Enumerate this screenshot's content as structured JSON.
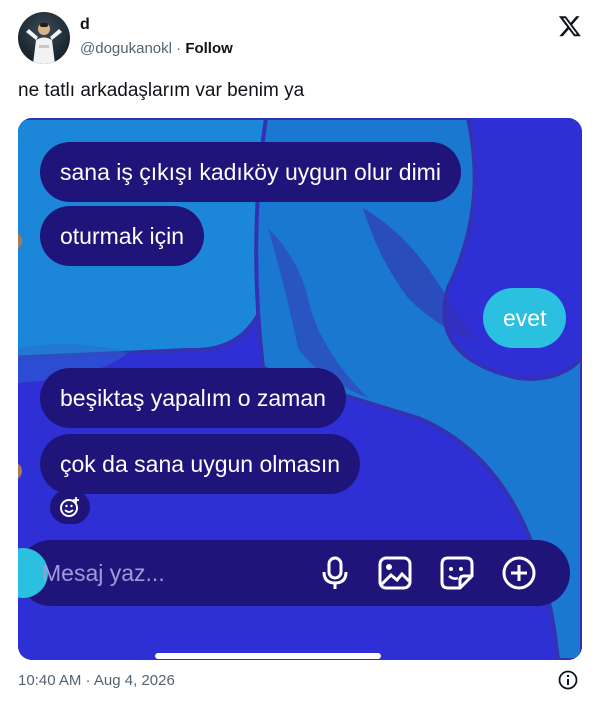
{
  "tweet": {
    "display_name": "d",
    "handle": "@dogukanokl",
    "separator": " · ",
    "follow_label": "Follow",
    "text": "ne tatlı arkadaşlarım var benim ya",
    "timestamp": "10:40 AM · Aug 4, 2026"
  },
  "chat": {
    "messages": [
      {
        "text": "sana iş çıkışı kadıköy uygun olur dimi",
        "side": "received"
      },
      {
        "text": "oturmak için",
        "side": "received"
      },
      {
        "text": "evet",
        "side": "sent"
      },
      {
        "text": "beşiktaş yapalım o zaman",
        "side": "received"
      },
      {
        "text": "çok da sana uygun olmasın",
        "side": "received"
      }
    ],
    "composer_placeholder": "Mesaj yaz...",
    "colors": {
      "background": "#2f2fd6",
      "received_bubble": "#1f147a",
      "sent_bubble": "#2cc0e0"
    }
  },
  "icons": [
    "x-logo-icon",
    "smiley-reaction-icon",
    "microphone-icon",
    "image-icon",
    "sticker-icon",
    "plus-circle-icon",
    "info-icon"
  ]
}
